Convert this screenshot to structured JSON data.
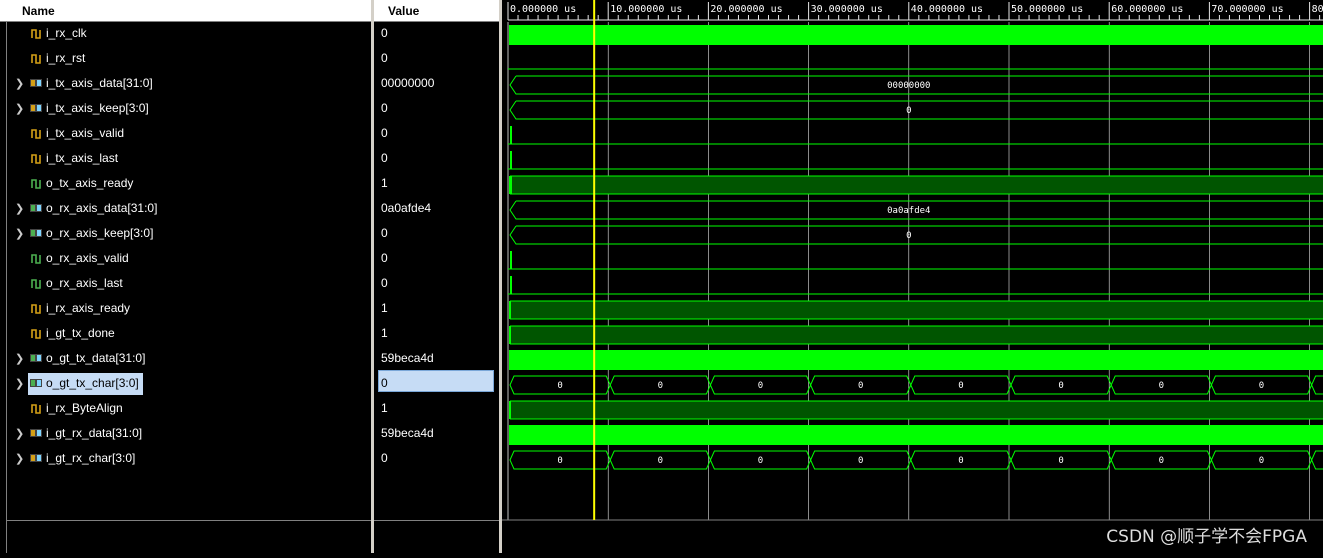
{
  "headers": {
    "name": "Name",
    "value": "Value"
  },
  "signals": [
    {
      "name": "i_rx_clk",
      "value": "0",
      "kind": "bit",
      "expandable": false,
      "icon": "input-bit-icon"
    },
    {
      "name": "i_rx_rst",
      "value": "0",
      "kind": "bit",
      "expandable": false,
      "icon": "input-bit-icon"
    },
    {
      "name": "i_tx_axis_data[31:0]",
      "value": "00000000",
      "kind": "bus",
      "expandable": true,
      "icon": "input-bus-icon"
    },
    {
      "name": "i_tx_axis_keep[3:0]",
      "value": "0",
      "kind": "bus",
      "expandable": true,
      "icon": "input-bus-icon"
    },
    {
      "name": "i_tx_axis_valid",
      "value": "0",
      "kind": "bit",
      "expandable": false,
      "icon": "input-bit-icon"
    },
    {
      "name": "i_tx_axis_last",
      "value": "0",
      "kind": "bit",
      "expandable": false,
      "icon": "input-bit-icon"
    },
    {
      "name": "o_tx_axis_ready",
      "value": "1",
      "kind": "bit",
      "expandable": false,
      "icon": "output-bit-icon"
    },
    {
      "name": "o_rx_axis_data[31:0]",
      "value": "0a0afde4",
      "kind": "bus",
      "expandable": true,
      "icon": "output-bus-icon"
    },
    {
      "name": "o_rx_axis_keep[3:0]",
      "value": "0",
      "kind": "bus",
      "expandable": true,
      "icon": "output-bus-icon"
    },
    {
      "name": "o_rx_axis_valid",
      "value": "0",
      "kind": "bit",
      "expandable": false,
      "icon": "output-bit-icon"
    },
    {
      "name": "o_rx_axis_last",
      "value": "0",
      "kind": "bit",
      "expandable": false,
      "icon": "output-bit-icon"
    },
    {
      "name": "i_rx_axis_ready",
      "value": "1",
      "kind": "bit",
      "expandable": false,
      "icon": "input-bit-icon"
    },
    {
      "name": "i_gt_tx_done",
      "value": "1",
      "kind": "bit",
      "expandable": false,
      "icon": "input-bit-icon"
    },
    {
      "name": "o_gt_tx_data[31:0]",
      "value": "59beca4d",
      "kind": "bus",
      "expandable": true,
      "icon": "output-bus-icon"
    },
    {
      "name": "o_gt_tx_char[3:0]",
      "value": "0",
      "kind": "bus",
      "expandable": true,
      "icon": "output-bus-icon",
      "selected": true
    },
    {
      "name": "i_rx_ByteAlign",
      "value": "1",
      "kind": "bit",
      "expandable": false,
      "icon": "input-bit-icon"
    },
    {
      "name": "i_gt_rx_data[31:0]",
      "value": "59beca4d",
      "kind": "bus",
      "expandable": true,
      "icon": "input-bus-icon"
    },
    {
      "name": "i_gt_rx_char[3:0]",
      "value": "0",
      "kind": "bus",
      "expandable": true,
      "icon": "input-bus-icon"
    }
  ],
  "time_axis": {
    "unit": "us",
    "ticks": [
      "0.000000 us",
      "10.000000 us",
      "20.000000 us",
      "30.000000 us",
      "40.000000 us",
      "50.000000 us",
      "60.000000 us",
      "70.000000 us",
      "80"
    ]
  },
  "cursor": {
    "time_us": 8.6
  },
  "waves": {
    "bus_labels": {
      "i_tx_axis_data[31:0]": "00000000",
      "i_tx_axis_keep[3:0]": "0",
      "o_rx_axis_data[31:0]": "0a0afde4",
      "o_rx_axis_keep[3:0]": "0",
      "o_gt_tx_char[3:0]": [
        "0",
        "0",
        "0",
        "0",
        "0",
        "0",
        "0",
        "0"
      ],
      "i_gt_rx_char[3:0]": [
        "0",
        "0",
        "0",
        "0",
        "0",
        "0",
        "0",
        "0"
      ]
    }
  },
  "colors": {
    "wave_bright": "#00ff00",
    "wave_dark": "#005500",
    "grid": "#e8e8e8",
    "cursor": "#ffff00",
    "header_bg": "#ffffff",
    "selection": "#c6dcf5"
  },
  "watermark": "CSDN @顺子学不会FPGA"
}
